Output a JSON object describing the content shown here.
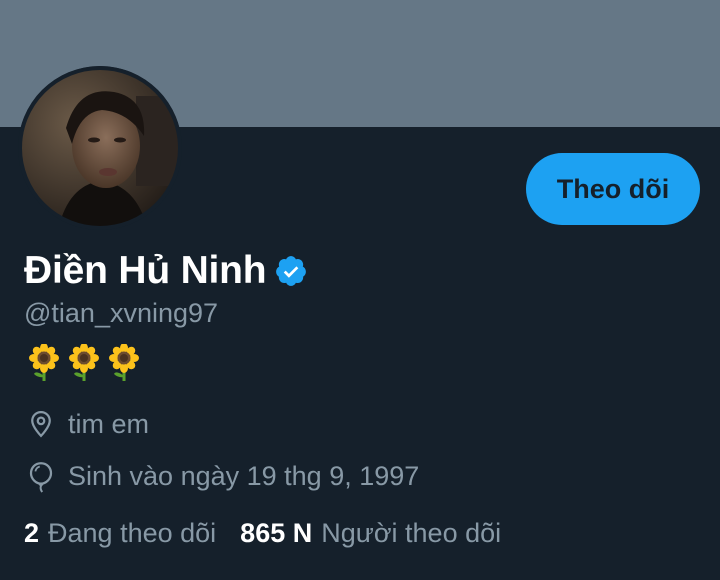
{
  "profile": {
    "display_name": "Điền Hủ Ninh",
    "handle": "@tian_xvning97",
    "bio_emojis": [
      "sunflower",
      "sunflower",
      "sunflower"
    ],
    "location": "tim em",
    "birthday": "Sinh vào ngày 19 thg 9, 1997",
    "verified": true
  },
  "actions": {
    "follow_label": "Theo dõi"
  },
  "stats": {
    "following_count": "2",
    "following_label": "Đang theo dõi",
    "followers_count": "865 N",
    "followers_label": "Người theo dõi"
  },
  "colors": {
    "background": "#15202b",
    "banner": "#657786",
    "accent": "#1da1f2",
    "secondary_text": "#8899a6",
    "primary_text": "#ffffff"
  },
  "icons": {
    "verified": "verified-badge-icon",
    "location": "location-pin-icon",
    "birthday": "balloon-icon"
  }
}
